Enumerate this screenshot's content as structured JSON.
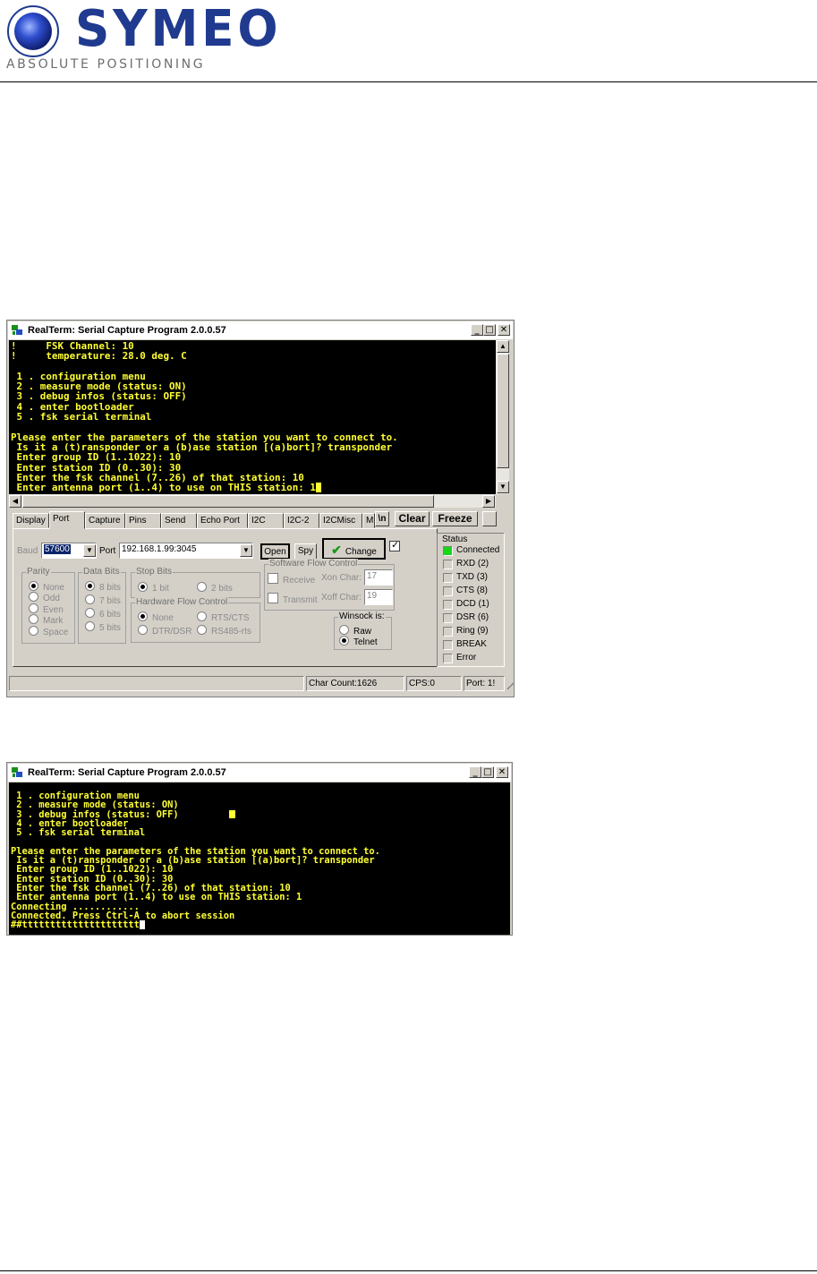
{
  "header": {
    "logo_text": "SYMEO",
    "logo_subtitle": "ABSOLUTE POSITIONING",
    "brand_color": "#1f3a8f"
  },
  "window1": {
    "title": "RealTerm: Serial Capture Program 2.0.0.57",
    "terminal_lines": [
      "!     FSK Channel: 10",
      "!     temperature: 28.0 deg. C",
      "",
      " 1 . configuration menu",
      " 2 . measure mode (status: ON)",
      " 3 . debug infos (status: OFF)",
      " 4 . enter bootloader",
      " 5 . fsk serial terminal",
      "",
      "Please enter the parameters of the station you want to connect to.",
      " Is it a (t)ransponder or a (b)ase station [(a)bort]? transponder",
      " Enter group ID (1..1022): 10",
      " Enter station ID (0..30): 30",
      " Enter the fsk channel (7..26) of that station: 10",
      " Enter antenna port (1..4) to use on THIS station: 1"
    ],
    "tabs": [
      "Display",
      "Port",
      "Capture",
      "Pins",
      "Send",
      "Echo Port",
      "I2C",
      "I2C-2",
      "I2CMisc",
      "M"
    ],
    "active_tab": "Port",
    "buttons": {
      "scroll_left": "\\n",
      "clear": "Clear",
      "freeze": "Freeze"
    },
    "port": {
      "baud_label": "Baud",
      "baud_value": "57600",
      "port_label": "Port",
      "port_value": "192.168.1.99:3045",
      "open_button": "Open",
      "spy_button": "Spy",
      "change_button": "Change",
      "parity": {
        "label": "Parity",
        "options": [
          "None",
          "Odd",
          "Even",
          "Mark",
          "Space"
        ],
        "selected": "None"
      },
      "data_bits": {
        "label": "Data Bits",
        "options": [
          "8 bits",
          "7 bits",
          "6 bits",
          "5 bits"
        ],
        "selected": "8 bits"
      },
      "stop_bits": {
        "label": "Stop Bits",
        "options": [
          "1 bit",
          "2 bits"
        ],
        "selected": "1 bit"
      },
      "hw_flow": {
        "label": "Hardware Flow Control",
        "options": [
          "None",
          "RTS/CTS",
          "DTR/DSR",
          "RS485-rts"
        ],
        "selected": "None"
      },
      "sw_flow": {
        "label": "Software Flow Control",
        "receive": "Receive",
        "transmit": "Transmit",
        "xon_label": "Xon Char:",
        "xon_value": "17",
        "xoff_label": "Xoff Char:",
        "xoff_value": "19"
      },
      "winsock": {
        "label": "Winsock is:",
        "options": [
          "Raw",
          "Telnet"
        ],
        "selected": "Telnet"
      }
    },
    "status": {
      "label": "Status",
      "items": [
        {
          "label": "Connected",
          "on": true
        },
        {
          "label": "RXD (2)",
          "on": false
        },
        {
          "label": "TXD (3)",
          "on": false
        },
        {
          "label": "CTS (8)",
          "on": false
        },
        {
          "label": "DCD (1)",
          "on": false
        },
        {
          "label": "DSR (6)",
          "on": false
        },
        {
          "label": "Ring (9)",
          "on": false
        },
        {
          "label": "BREAK",
          "on": false
        },
        {
          "label": "Error",
          "on": false
        }
      ],
      "led_on_color": "#19d619"
    },
    "statusbar": {
      "char_count": "Char Count:1626",
      "cps": "CPS:0",
      "port": "Port: 1!"
    }
  },
  "window2": {
    "title": "RealTerm: Serial Capture Program 2.0.0.57",
    "terminal_lines": [
      " 1 . configuration menu",
      " 2 . measure mode (status: ON)",
      " 3 . debug infos (status: OFF)",
      " 4 . enter bootloader",
      " 5 . fsk serial terminal",
      "",
      "Please enter the parameters of the station you want to connect to.",
      " Is it a (t)ransponder or a (b)ase station [(a)bort]? transponder",
      " Enter group ID (1..1022): 10",
      " Enter station ID (0..30): 30",
      " Enter the fsk channel (7..26) of that station: 10",
      " Enter antenna port (1..4) to use on THIS station: 1",
      "Connecting ............",
      "Connected. Press Ctrl-A to abort session",
      "##ttttttttttttttttttttt"
    ]
  },
  "terminal_text_color": "#ffff33"
}
